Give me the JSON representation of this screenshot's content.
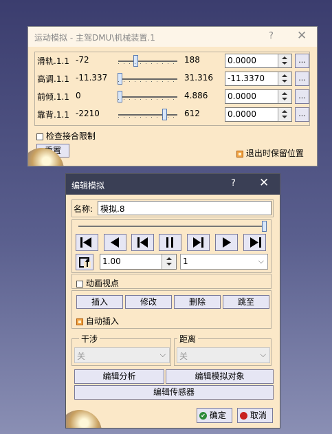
{
  "w1": {
    "title": "运动模拟 - 主驾DMU\\机械装置.1",
    "help_label": "?",
    "close_label": "✕",
    "joints": [
      {
        "name": "滑轨.1.1",
        "min": "-72",
        "max": "188",
        "value": "0.0000",
        "slider": 0.28,
        "more_label": "..."
      },
      {
        "name": "高调.1.1",
        "min": "-11.337",
        "max": "31.316",
        "value": "-11.3370",
        "slider": 0.0,
        "more_label": "..."
      },
      {
        "name": "前倾.1.1",
        "min": "0",
        "max": "4.886",
        "value": "0.0000",
        "slider": 0.0,
        "more_label": "..."
      },
      {
        "name": "靠背.1.1",
        "min": "-2210",
        "max": "612",
        "value": "0.0000",
        "slider": 0.78,
        "more_label": "..."
      }
    ],
    "check_limits_label": "检查接合限制",
    "check_limits_checked": false,
    "reset_label": "重置",
    "keep_pos_label": "退出时保留位置",
    "keep_pos_checked": true
  },
  "w2": {
    "title": "编辑模拟",
    "help_label": "?",
    "close_label": "✕",
    "name_label": "名称:",
    "name_value": "模拟.8",
    "slider_position": 1.0,
    "step_value": "1.00",
    "frame_value": "1",
    "animate_viewpoint_label": "动画视点",
    "animate_viewpoint_checked": false,
    "insert_label": "插入",
    "modify_label": "修改",
    "delete_label": "删除",
    "jump_label": "跳至",
    "auto_insert_label": "自动插入",
    "auto_insert_checked": true,
    "interference_label": "干涉",
    "interference_value": "关",
    "distance_label": "距离",
    "distance_value": "关",
    "edit_analysis_label": "编辑分析",
    "edit_sim_objects_label": "编辑模拟对象",
    "edit_sensors_label": "编辑传感器",
    "ok_label": "确定",
    "cancel_label": "取消"
  }
}
